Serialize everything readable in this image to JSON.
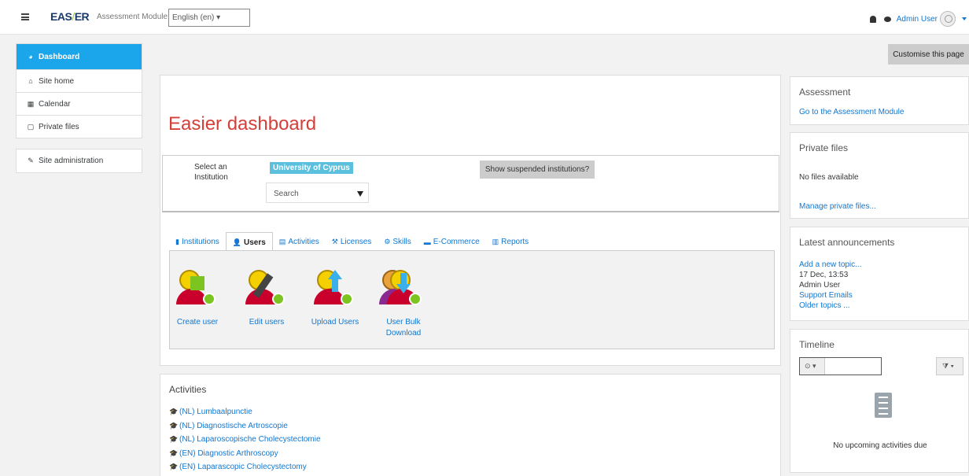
{
  "header": {
    "menu_icon": "hamburger-icon",
    "logo_text_a": "EAS",
    "logo_text_b": "ER",
    "module_name": "Assessment Module",
    "language": "English (en) ▾",
    "user_name": "Admin User",
    "notification_icon": "bell-icon",
    "message_icon": "chat-icon"
  },
  "nav": {
    "items": [
      {
        "label": "Dashboard",
        "icon": "dashboard-icon",
        "active": true
      },
      {
        "label": "Site home",
        "icon": "home-icon"
      },
      {
        "label": "Calendar",
        "icon": "calendar-icon"
      },
      {
        "label": "Private files",
        "icon": "file-icon"
      }
    ],
    "admin": {
      "label": "Site administration",
      "icon": "wrench-icon"
    }
  },
  "customise_label": "Customise this page",
  "main": {
    "title": "Easier dashboard",
    "select_label": "Select an Institution",
    "institution": "University of Cyprus",
    "search_placeholder": "Search",
    "suspended_button": "Show suspended institutions?",
    "tabs": [
      {
        "label": "Institutions",
        "icon": "building-icon"
      },
      {
        "label": "Users",
        "icon": "user-icon",
        "active": true
      },
      {
        "label": "Activities",
        "icon": "document-icon"
      },
      {
        "label": "Licenses",
        "icon": "gavel-icon"
      },
      {
        "label": "Skills",
        "icon": "cogs-icon"
      },
      {
        "label": "E-Commerce",
        "icon": "truck-icon"
      },
      {
        "label": "Reports",
        "icon": "bar-chart-icon"
      }
    ],
    "user_actions": [
      {
        "label": "Create user"
      },
      {
        "label": "Edit users"
      },
      {
        "label": "Upload Users"
      },
      {
        "label": "User Bulk Download"
      }
    ]
  },
  "activities": {
    "title": "Activities",
    "items": [
      "(NL) Lumbaalpunctie",
      "(NL) Diagnostische Artroscopie",
      "(NL) Laparoscopische Cholecystectomie",
      "(EN) Diagnostic Arthroscopy",
      "(EN) Laparascopic Cholecystectomy"
    ]
  },
  "blocks": {
    "assessment": {
      "title": "Assessment",
      "link": "Go to the Assessment Module"
    },
    "private_files": {
      "title": "Private files",
      "empty": "No files available",
      "link": "Manage private files..."
    },
    "announcements": {
      "title": "Latest announcements",
      "add_link": "Add a new topic...",
      "date": "17 Dec, 13:53",
      "author": "Admin User",
      "topic": "Support Emails",
      "older": "Older topics ..."
    },
    "timeline": {
      "title": "Timeline",
      "empty": "No upcoming activities due"
    }
  }
}
